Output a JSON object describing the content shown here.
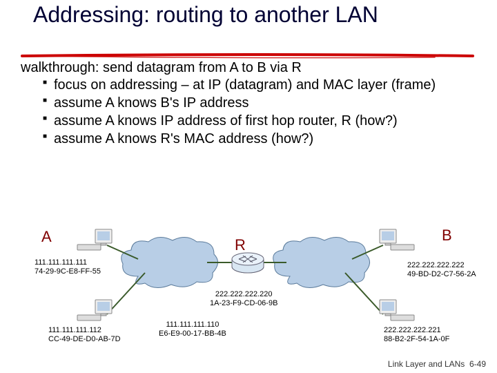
{
  "title": "Addressing: routing to another LAN",
  "intro": "walkthrough: send datagram from A to B via R",
  "bullets": [
    "focus on addressing – at IP (datagram) and MAC layer (frame)",
    "assume A knows B's IP address",
    "assume A knows IP address of first hop router, R (how?)",
    "assume A knows R's MAC address (how?)"
  ],
  "labels": {
    "A": "A",
    "B": "B",
    "R": "R"
  },
  "hosts": {
    "a": {
      "ip": "111.111.111.111",
      "mac": "74-29-9C-E8-FF-55"
    },
    "left2": {
      "ip": "111.111.111.112",
      "mac": "CC-49-DE-D0-AB-7D"
    },
    "r_left": {
      "ip": "111.111.111.110",
      "mac": "E6-E9-00-17-BB-4B"
    },
    "r_right": {
      "ip": "222.222.222.220",
      "mac": "1A-23-F9-CD-06-9B"
    },
    "b": {
      "ip": "222.222.222.222",
      "mac": "49-BD-D2-C7-56-2A"
    },
    "right2": {
      "ip": "222.222.222.221",
      "mac": "88-B2-2F-54-1A-0F"
    }
  },
  "footer": {
    "text": "Link Layer and LANs",
    "page": "6-49"
  }
}
